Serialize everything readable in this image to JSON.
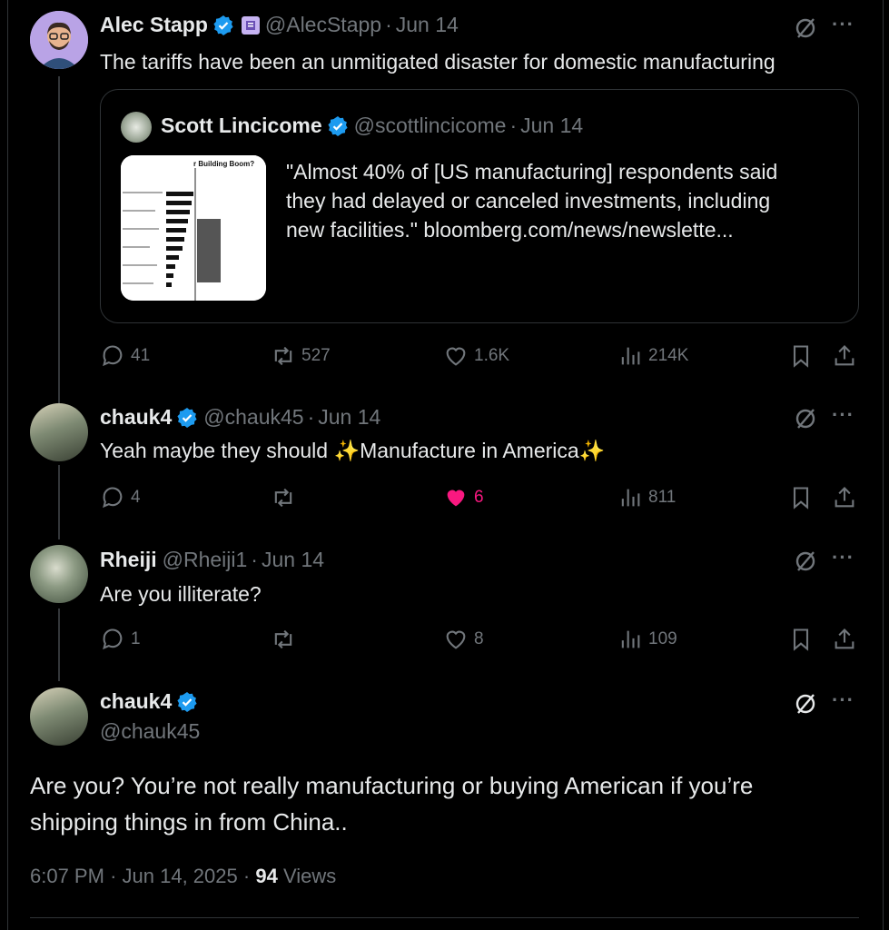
{
  "tweet1": {
    "name": "Alec Stapp",
    "handle": "@AlecStapp",
    "date": "Jun 14",
    "text": "The tariffs have been an unmitigated disaster for domestic manufacturing",
    "quote": {
      "name": "Scott Lincicome",
      "handle": "@scottlincicome",
      "date": "Jun 14",
      "thumb_title": "r Building Boom?",
      "text_lines": [
        "\"Almost 40% of [US manufacturing] respondents said",
        "they had delayed or canceled investments, including",
        "new facilities.\" bloomberg.com/news/newslette..."
      ]
    },
    "replies": "41",
    "reposts": "527",
    "likes": "1.6K",
    "views": "214K"
  },
  "tweet2": {
    "name": "chauk4",
    "handle": "@chauk45",
    "date": "Jun 14",
    "text": "Yeah maybe they should ✨Manufacture in America✨",
    "replies": "4",
    "reposts": "",
    "likes": "6",
    "views": "811"
  },
  "tweet3": {
    "name": "Rheiji",
    "handle": "@Rheiji1",
    "date": "Jun 14",
    "text": "Are you illiterate?",
    "replies": "1",
    "reposts": "",
    "likes": "8",
    "views": "109"
  },
  "main": {
    "name": "chauk4",
    "handle": "@chauk45",
    "text_lines": [
      "Are you? You’re not really manufacturing or buying American if you’re",
      "shipping things in from China.."
    ],
    "time": "6:07 PM",
    "date": "Jun 14, 2025",
    "views_count": "94",
    "views_label": "Views"
  },
  "colors": {
    "background": "#000000",
    "text": "#e7e9ea",
    "muted": "#71767b",
    "verified": "#1d9bf0",
    "like": "#f91880"
  },
  "icons": [
    "verified-badge-icon",
    "affiliate-badge-icon",
    "grok-icon",
    "more-icon",
    "reply-icon",
    "repost-icon",
    "like-icon",
    "views-icon",
    "bookmark-icon",
    "share-icon"
  ]
}
